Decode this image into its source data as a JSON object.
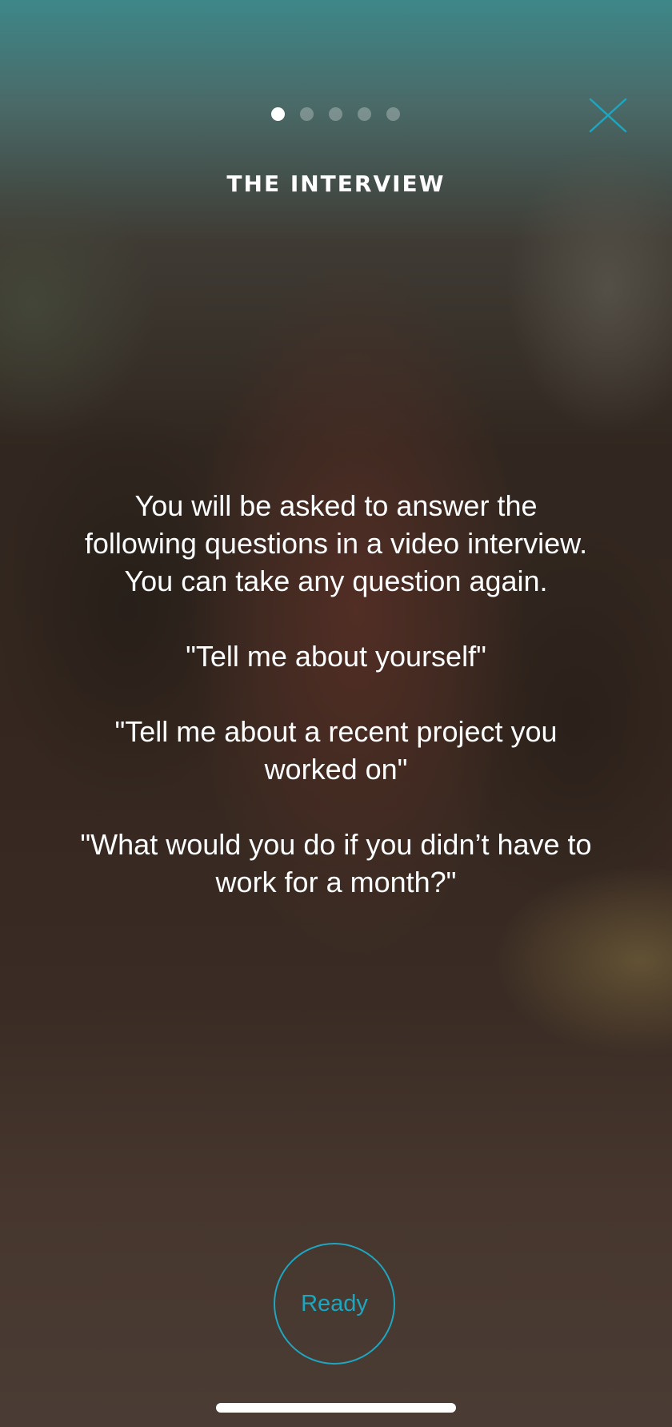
{
  "onboarding": {
    "page_indicator": {
      "total_pages": 5,
      "current_page": 1
    },
    "title": "THE INTERVIEW",
    "intro": "You will be asked to answer the following questions in a video interview. You can take any question again.",
    "questions": [
      "\"Tell me about yourself\"",
      "\"Tell me about a recent project you worked on\"",
      "\"What would you do if you didn’t have to work for a month?\""
    ],
    "ready_button_label": "Ready"
  },
  "icons": {
    "close": "close-icon"
  },
  "colors": {
    "accent": "#1ea5bf",
    "text": "#ffffff",
    "dot_inactive": "rgba(255,255,255,0.28)"
  }
}
